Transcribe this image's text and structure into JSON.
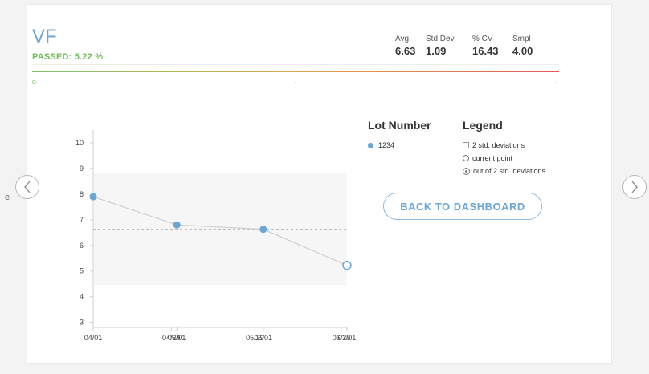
{
  "side_text": "e",
  "nav": {
    "prev_icon": "chevron-left-icon",
    "next_icon": "chevron-right-icon"
  },
  "header": {
    "title": "VF",
    "status": "PASSED: 5.22 %",
    "stats": [
      {
        "label": "Avg",
        "value": "6.63"
      },
      {
        "label": "Std Dev",
        "value": "1.09"
      },
      {
        "label": "% CV",
        "value": "16.43"
      },
      {
        "label": "Smpl",
        "value": "4.00"
      }
    ]
  },
  "gauge": {
    "left_label": "0-",
    "mid_label": "-",
    "right_label": "-"
  },
  "lot": {
    "title": "Lot Number",
    "items": [
      "1234"
    ]
  },
  "legend": {
    "title": "Legend",
    "items": [
      "2 std. deviations",
      "current point",
      "out of 2 std. deviations"
    ]
  },
  "actions": {
    "back_label": "BACK TO DASHBOARD"
  },
  "colors": {
    "accent": "#6aa6d6",
    "passed": "#6fbf59",
    "band": "#f6f6f6",
    "line": "#cfcfcf"
  },
  "chart_data": {
    "type": "line",
    "x_ticks": [
      "04/01",
      "04/29",
      "05/01",
      "05/29",
      "06/01",
      "06/29",
      "07/01"
    ],
    "y_ticks": [
      3,
      4,
      5,
      6,
      7,
      8,
      9,
      10
    ],
    "ylim": [
      2.8,
      10.5
    ],
    "xlim": [
      "04/01",
      "07/01"
    ],
    "points": [
      {
        "x": "04/01",
        "y": 7.9
      },
      {
        "x": "05/01",
        "y": 6.8
      },
      {
        "x": "06/01",
        "y": 6.63
      },
      {
        "x": "07/01",
        "y": 5.22,
        "current": true
      }
    ],
    "mean": 6.63,
    "band": [
      4.45,
      8.81
    ],
    "grid": false
  }
}
